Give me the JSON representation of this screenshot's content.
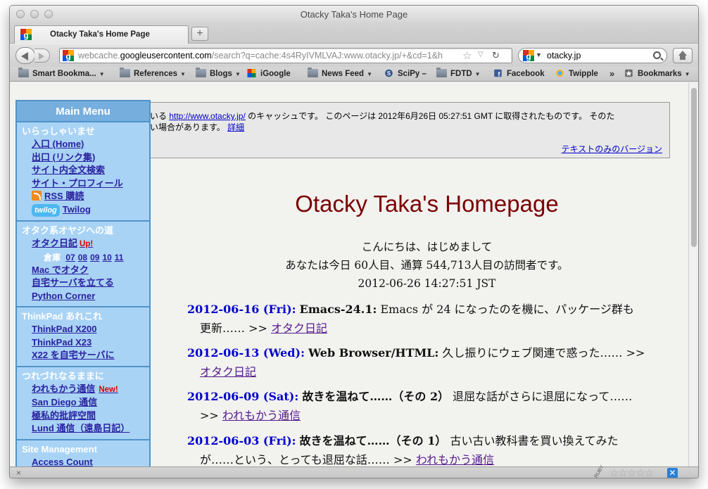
{
  "window": {
    "title": "Otacky Taka's Home Page"
  },
  "tabs": [
    {
      "label": "Otacky Taka's Home Page"
    }
  ],
  "newtab": {
    "label": "+"
  },
  "urlbar": {
    "prefix": "webcache.",
    "host": "googleusercontent.com",
    "path": "/search?q=cache:4s4RyIVMLVAJ:www.otacky.jp/+&cd=1&h"
  },
  "search": {
    "engine_icon": "google-icon",
    "value": "otacky.jp"
  },
  "bookmarks": [
    {
      "label": "Smart Bookma...",
      "icon": "folder-icon",
      "dropdown": true
    },
    {
      "label": "References",
      "icon": "folder-icon",
      "dropdown": true
    },
    {
      "label": "Blogs",
      "icon": "folder-icon",
      "dropdown": true
    },
    {
      "label": "iGoogle",
      "icon": "google-icon",
      "dropdown": false
    },
    {
      "label": "News Feed",
      "icon": "folder-icon",
      "dropdown": true
    },
    {
      "label": "SciPy –",
      "icon": "scipy-icon",
      "dropdown": false
    },
    {
      "label": "FDTD",
      "icon": "folder-icon",
      "dropdown": true
    },
    {
      "label": "Facebook",
      "icon": "facebook-icon",
      "dropdown": false
    },
    {
      "label": "Twipple",
      "icon": "twipple-icon",
      "dropdown": false
    }
  ],
  "bookmarks_more": "»",
  "bookmarks_menu": {
    "label": "Bookmarks"
  },
  "cache": {
    "line1_pre": "いる ",
    "line1_link": "http://www.otacky.jp/",
    "line1_post": " のキャッシュです。 このページは 2012年6月26日 05:27:51 GMT に取得されたものです。 そのた",
    "line2_pre": "い場合があります。 ",
    "line2_link": "詳細",
    "text_only": "テキストのみのバージョン"
  },
  "menu": {
    "title": "Main Menu",
    "sections": [
      {
        "title": "いらっしゃいませ",
        "items": [
          "入口 (Home)",
          "出口 (リンク集)",
          "サイト内全文検索",
          "サイト・プロフィール",
          "RSS 購読",
          "Twilog"
        ]
      },
      {
        "title": "オタク系オヤジへの道",
        "items": [
          "オタク日記",
          "Mac でオタク",
          "自宅サーバを立てる",
          "Python Corner"
        ],
        "badge_up": "Up!",
        "archive_label": "倉庫",
        "archive_years": [
          "07",
          "08",
          "09",
          "10",
          "11"
        ]
      },
      {
        "title": "ThinkPad あれこれ",
        "items": [
          "ThinkPad X200",
          "ThinkPad X23",
          "X22 を自宅サーバに"
        ]
      },
      {
        "title": "つれづれなるままに",
        "items": [
          "われもかう通信",
          "San Diego 通信",
          "極私的批評空間",
          "Lund 通信（遠島日記）"
        ],
        "badge_new": "New!"
      },
      {
        "title": "Site Management",
        "items": [
          "Access Count"
        ]
      }
    ],
    "twilog_logo": "twilog"
  },
  "page": {
    "title": "Otacky Taka's Homepage",
    "greeting": "こんにちは、はじめまして",
    "visitors": "あなたは今日 60人目、通算 544,713人目の訪問者です。",
    "timestamp": "2012-06-26 14:27:51 JST"
  },
  "news": [
    {
      "date": "2012-06-16 (Fri):",
      "topic": "Emacs-24.1:",
      "line1": " Emacs が 24 になったのを機に、パッケージ群も",
      "line2": "更新…… >> ",
      "link": "オタク日記"
    },
    {
      "date": "2012-06-13 (Wed):",
      "topic": "Web Browser/HTML:",
      "line1": " 久し振りにウェブ関連で惑った…… >>",
      "line2": "",
      "link": "オタク日記"
    },
    {
      "date": "2012-06-09 (Sat):",
      "topic": "故きを温ねて……（その 2）",
      "line1": " 退屈な話がさらに退屈になって……",
      "line2": ">> ",
      "link": "われもかう通信"
    },
    {
      "date": "2012-06-03 (Fri):",
      "topic": "故きを温ねて……（その 1）",
      "line1": " 古い古い教科書を買い換えてみた",
      "line2": "が……という、とっても退屈な話…… >> ",
      "link": "われもかう通信"
    }
  ],
  "status": {
    "close": "×",
    "ruby": "RUBY",
    "stars": "☆☆☆☆☆",
    "ext": "✕"
  },
  "colors": {
    "menu_bg": "#a9d3f5",
    "menu_border": "#4f93c9",
    "title_red": "#7a0000",
    "date_blue": "#0000cc",
    "link_purple": "#551a8b"
  }
}
